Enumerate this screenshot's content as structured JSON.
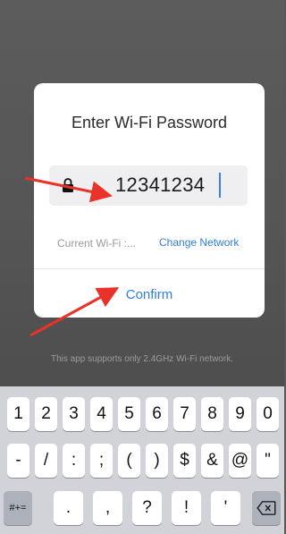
{
  "dialog": {
    "title": "Enter Wi-Fi Password",
    "password_value": "12341234",
    "current_wifi_label": "Current Wi-Fi :...",
    "change_network_label": "Change Network",
    "confirm_label": "Confirm"
  },
  "notice": "This app supports only 2.4GHz Wi-Fi network.",
  "keyboard": {
    "row1": [
      "1",
      "2",
      "3",
      "4",
      "5",
      "6",
      "7",
      "8",
      "9",
      "0"
    ],
    "row2": [
      "-",
      "/",
      ":",
      ";",
      "(",
      ")",
      "$",
      "&",
      "@",
      "\""
    ],
    "row3": {
      "toggle_label": "#+=",
      "keys": [
        ".",
        ",",
        "?",
        "!",
        "'"
      ],
      "delete_icon": "backspace-icon"
    }
  },
  "annotations": {
    "color": "#e8322a"
  },
  "colors": {
    "accent": "#2f7de1",
    "caret": "#3a7cf2"
  }
}
